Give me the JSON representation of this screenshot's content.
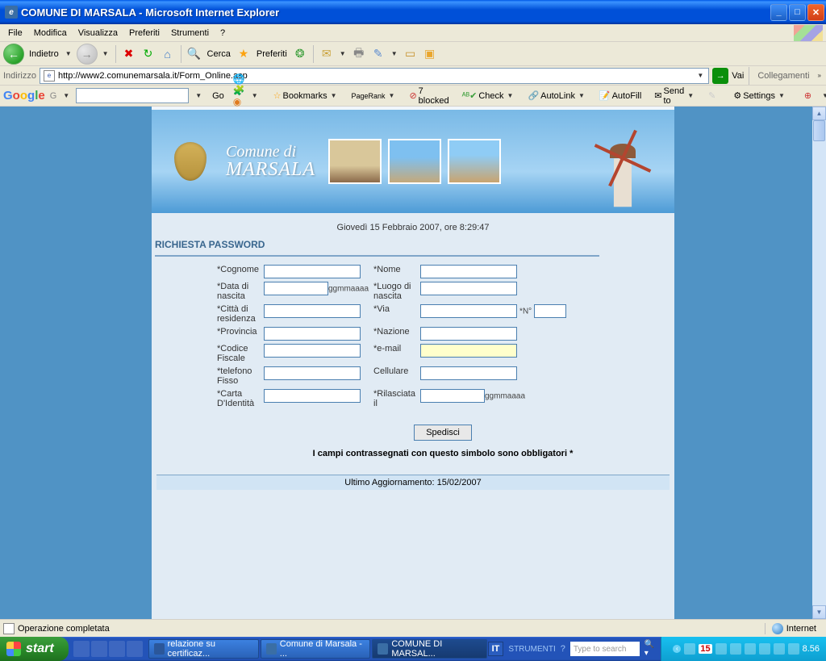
{
  "window": {
    "title": "COMUNE DI MARSALA - Microsoft Internet Explorer"
  },
  "menu": {
    "file": "File",
    "edit": "Modifica",
    "view": "Visualizza",
    "favorites": "Preferiti",
    "tools": "Strumenti",
    "help": "?"
  },
  "toolbar": {
    "back": "Indietro",
    "search": "Cerca",
    "favorites": "Preferiti"
  },
  "address": {
    "label": "Indirizzo",
    "url": "http://www2.comunemarsala.it/Form_Online.asp",
    "go": "Vai",
    "links": "Collegamenti"
  },
  "gbar": {
    "go": "Go",
    "bookmarks": "Bookmarks",
    "pagerank": "PageRank",
    "blocked": "7 blocked",
    "check": "Check",
    "autolink": "AutoLink",
    "autofill": "AutoFill",
    "sendto": "Send to",
    "settings": "Settings"
  },
  "hero": {
    "line1": "Comune di",
    "line2": "MARSALA"
  },
  "page": {
    "date": "Giovedì 15 Febbraio 2007, ore 8:29:47",
    "heading": "RICHIESTA PASSWORD",
    "submit": "Spedisci",
    "required_note": "I campi contrassegnati con questo simbolo sono obbligatori *",
    "last_update": "Ultimo Aggiornamento: 15/02/2007"
  },
  "form": {
    "cognome": "*Cognome",
    "nome": "*Nome",
    "data_nascita": "*Data di nascita",
    "luogo_nascita": "*Luogo di nascita",
    "citta": "*Città di residenza",
    "via": "*Via",
    "num": "*N°",
    "provincia": "*Provincia",
    "nazione": "*Nazione",
    "cf": "*Codice Fiscale",
    "email": "*e-mail",
    "tel": "*telefono Fisso",
    "cell": "Cellulare",
    "carta": "*Carta D'Identità",
    "rilasciata": "*Rilasciata il",
    "hint_date": "ggmmaaaa"
  },
  "status": {
    "done": "Operazione completata",
    "zone": "Internet"
  },
  "taskbar": {
    "start": "start",
    "tasks": [
      "relazione su certificaz...",
      "Comune di Marsala - ...",
      "COMUNE DI MARSAL..."
    ],
    "lang": "IT",
    "lang_tool": "STRUMENTI",
    "search_ph": "Type to search",
    "clock": "8.56",
    "date_badge": "15"
  }
}
